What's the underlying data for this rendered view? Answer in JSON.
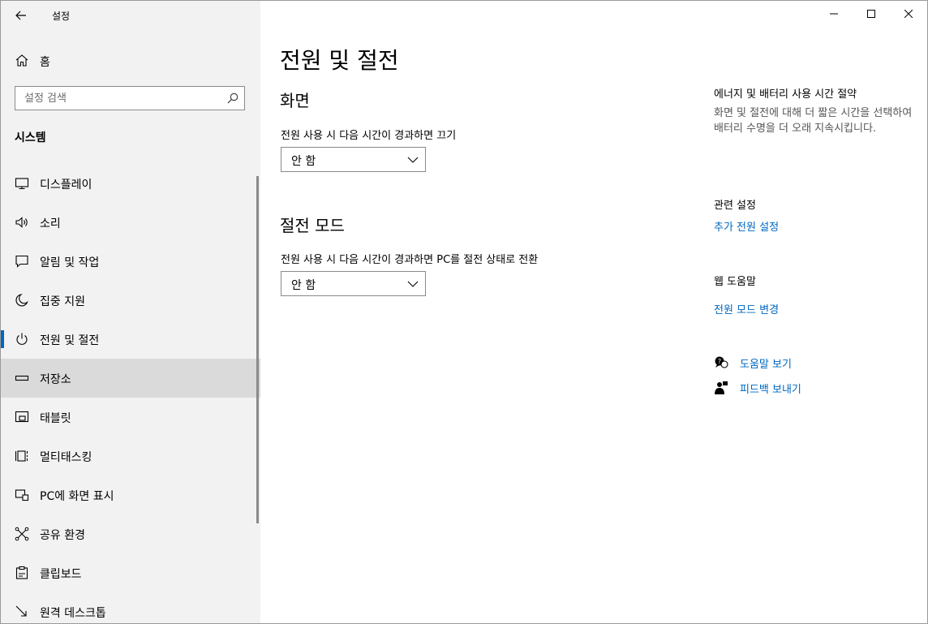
{
  "app": {
    "title": "설정"
  },
  "sidebar": {
    "home_label": "홈",
    "search_placeholder": "설정 검색",
    "section_title": "시스템",
    "items": [
      {
        "label": "디스플레이",
        "icon": "monitor-icon"
      },
      {
        "label": "소리",
        "icon": "speaker-icon"
      },
      {
        "label": "알림 및 작업",
        "icon": "notification-icon"
      },
      {
        "label": "집중 지원",
        "icon": "moon-icon"
      },
      {
        "label": "전원 및 절전",
        "icon": "power-icon",
        "selected": true
      },
      {
        "label": "저장소",
        "icon": "storage-icon",
        "hover": true
      },
      {
        "label": "태블릿",
        "icon": "tablet-icon"
      },
      {
        "label": "멀티태스킹",
        "icon": "multitasking-icon"
      },
      {
        "label": "PC에 화면 표시",
        "icon": "project-icon"
      },
      {
        "label": "공유 환경",
        "icon": "share-icon"
      },
      {
        "label": "클립보드",
        "icon": "clipboard-icon"
      },
      {
        "label": "원격 데스크톱",
        "icon": "remote-desktop-icon"
      }
    ]
  },
  "main": {
    "page_title": "전원 및 절전",
    "screen": {
      "heading": "화면",
      "label": "전원 사용 시 다음 시간이 경과하면 끄기",
      "value": "안 함"
    },
    "sleep": {
      "heading": "절전 모드",
      "label": "전원 사용 시 다음 시간이 경과하면 PC를 절전 상태로 전환",
      "value": "안 함"
    }
  },
  "right": {
    "energy_title": "에너지 및 배터리 사용 시간 절약",
    "energy_desc": "화면 및 절전에 대해 더 짧은 시간을 선택하여 배터리 수명을 더 오래 지속시킵니다.",
    "related_title": "관련 설정",
    "related_link": "추가 전원 설정",
    "web_help_title": "웹 도움말",
    "web_help_link": "전원 모드 변경",
    "get_help": "도움말 보기",
    "feedback": "피드백 보내기"
  },
  "colors": {
    "accent": "#0067c0",
    "sidebar_bg": "#f2f2f2",
    "hover_bg": "#dadada"
  }
}
